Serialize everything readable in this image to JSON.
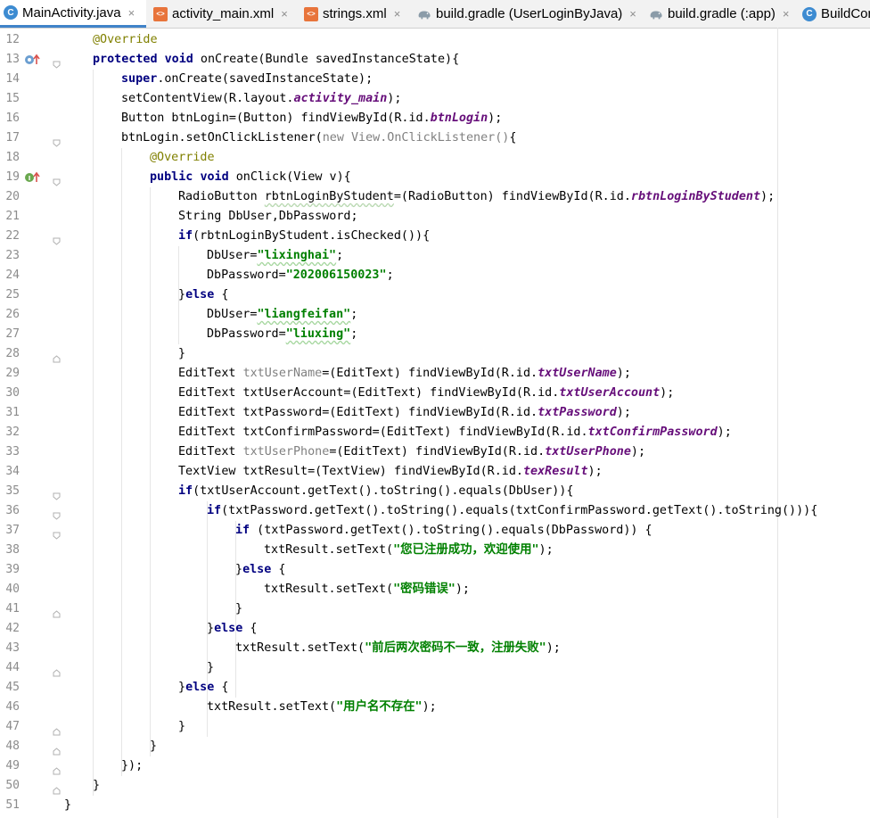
{
  "tabs": [
    {
      "label": "MainActivity.java",
      "icon": "java-class-icon",
      "active": true,
      "closable": true
    },
    {
      "label": "activity_main.xml",
      "icon": "xml-file-icon",
      "active": false,
      "closable": true
    },
    {
      "label": "strings.xml",
      "icon": "xml-file-icon",
      "active": false,
      "closable": true
    },
    {
      "label": "build.gradle (UserLoginByJava)",
      "icon": "gradle-elephant-icon",
      "active": false,
      "closable": true
    },
    {
      "label": "build.gradle (:app)",
      "icon": "gradle-elephant-icon",
      "active": false,
      "closable": true
    },
    {
      "label": "BuildCon",
      "icon": "java-class-icon",
      "active": false,
      "closable": false
    }
  ],
  "tab_close_glyph": "×",
  "line_numbers": [
    "12",
    "13",
    "14",
    "15",
    "16",
    "17",
    "18",
    "19",
    "20",
    "21",
    "22",
    "23",
    "24",
    "25",
    "26",
    "27",
    "28",
    "29",
    "30",
    "31",
    "32",
    "33",
    "34",
    "35",
    "36",
    "37",
    "38",
    "39",
    "40",
    "41",
    "42",
    "43",
    "44",
    "45",
    "46",
    "47",
    "48",
    "49",
    "50",
    "51"
  ],
  "code": {
    "l12": {
      "a": "@Override"
    },
    "l13": {
      "k1": "protected",
      "k2": "void",
      "t": " onCreate(Bundle savedInstanceState){"
    },
    "l14": {
      "k": "super",
      "t": ".onCreate(savedInstanceState);"
    },
    "l15": {
      "t1": "setContentView(R.layout.",
      "f": "activity_main",
      "t2": ");"
    },
    "l16": {
      "t1": "Button btnLogin=(Button) findViewById(R.id.",
      "f": "btnLogin",
      "t2": ");"
    },
    "l17": {
      "t1": "btnLogin.setOnClickListener(",
      "u1": "new",
      "u2": " View.OnClickListener()",
      "t2": "{"
    },
    "l18": {
      "a": "@Override"
    },
    "l19": {
      "k1": "public",
      "k2": "void",
      "t": " onClick(View v){"
    },
    "l20": {
      "t1": "RadioButton ",
      "w": "rbtnLoginByStudent",
      "t2": "=(RadioButton) findViewById(R.id.",
      "f": "rbtnLoginByStudent",
      "t3": ");"
    },
    "l21": {
      "t": "String DbUser,DbPassword;"
    },
    "l22": {
      "k": "if",
      "t": "(rbtnLoginByStudent.isChecked()){"
    },
    "l23": {
      "t1": "DbUser=",
      "s": "\"lixinghai\"",
      "t2": ";"
    },
    "l24": {
      "t1": "DbPassword=",
      "s": "\"202006150023\"",
      "t2": ";"
    },
    "l25": {
      "t1": "}",
      "k": "else",
      "t2": " {"
    },
    "l26": {
      "t1": "DbUser=",
      "s": "\"liangfeifan\"",
      "t2": ";"
    },
    "l27": {
      "t1": "DbPassword=",
      "s": "\"liuxing\"",
      "t2": ";"
    },
    "l28": {
      "t": "}"
    },
    "l29": {
      "t1": "EditText ",
      "u": "txtUserName",
      "t2": "=(EditText) findViewById(R.id.",
      "f": "txtUserName",
      "t3": ");"
    },
    "l30": {
      "t1": "EditText txtUserAccount=(EditText) findViewById(R.id.",
      "f": "txtUserAccount",
      "t2": ");"
    },
    "l31": {
      "t1": "EditText txtPassword=(EditText) findViewById(R.id.",
      "f": "txtPassword",
      "t2": ");"
    },
    "l32": {
      "t1": "EditText txtConfirmPassword=(EditText) findViewById(R.id.",
      "f": "txtConfirmPassword",
      "t2": ");"
    },
    "l33": {
      "t1": "EditText ",
      "u": "txtUserPhone",
      "t2": "=(EditText) findViewById(R.id.",
      "f": "txtUserPhone",
      "t3": ");"
    },
    "l34": {
      "t1": "TextView txtResult=(TextView) findViewById(R.id.",
      "f": "texResult",
      "t2": ");"
    },
    "l35": {
      "k": "if",
      "t": "(txtUserAccount.getText().toString().equals(DbUser)){"
    },
    "l36": {
      "k": "if",
      "t": "(txtPassword.getText().toString().equals(txtConfirmPassword.getText().toString())){"
    },
    "l37": {
      "k": "if",
      "t": " (txtPassword.getText().toString().equals(DbPassword)) {"
    },
    "l38": {
      "t1": "txtResult.setText(",
      "s": "\"您已注册成功，欢迎使用\"",
      "t2": ");"
    },
    "l39": {
      "t1": "}",
      "k": "else",
      "t2": " {"
    },
    "l40": {
      "t1": "txtResult.setText(",
      "s": "\"密码错误\"",
      "t2": ");"
    },
    "l41": {
      "t": "}"
    },
    "l42": {
      "t1": "}",
      "k": "else",
      "t2": " {"
    },
    "l43": {
      "t1": "txtResult.setText(",
      "s": "\"前后两次密码不一致，注册失败\"",
      "t2": ");"
    },
    "l44": {
      "t": "}"
    },
    "l45": {
      "t1": "}",
      "k": "else",
      "t2": " {"
    },
    "l46": {
      "t1": "txtResult.setText(",
      "s": "\"用户名不存在\"",
      "t2": ");"
    },
    "l47": {
      "t": "}"
    },
    "l48": {
      "t": "}"
    },
    "l49": {
      "t": "});"
    },
    "l50": {
      "t": "}"
    },
    "l51": {
      "t": "}"
    }
  },
  "colors": {
    "keyword": "#000080",
    "annotation": "#808000",
    "string": "#008000",
    "field": "#660e7a",
    "unused": "#808080",
    "line_number": "#8c8c8c",
    "active_tab_underline": "#4083c9"
  }
}
